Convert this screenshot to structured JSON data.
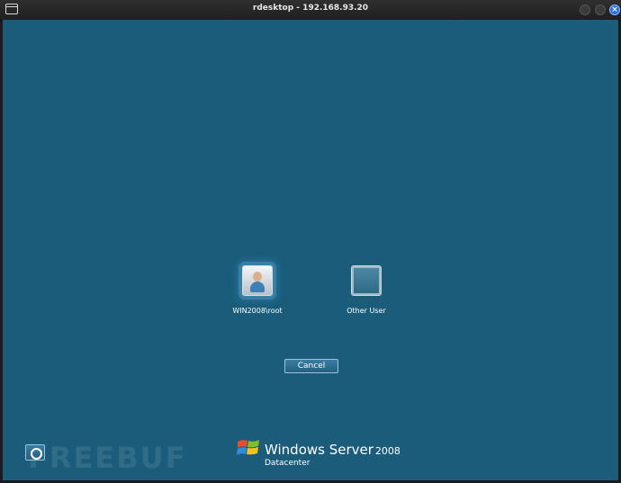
{
  "window": {
    "title": "rdesktop - 192.168.93.20"
  },
  "colors": {
    "desktop_bg": "#1a5c7a",
    "titlebar_bg": "#2a2a2a",
    "close_button": "#2f6fd6"
  },
  "login": {
    "tiles": [
      {
        "label": "WIN2008\\root",
        "icon": "user-avatar-icon",
        "selected": true
      },
      {
        "label": "Other User",
        "icon": "blank-user-icon",
        "selected": false
      }
    ],
    "cancel_label": "Cancel"
  },
  "ease_of_access": {
    "icon": "ease-of-access-icon"
  },
  "branding": {
    "brand": "Windows Server",
    "version": "2008",
    "edition": "Datacenter",
    "logo_icon": "windows-flag-icon"
  },
  "watermark": {
    "text": "FREEBUF"
  }
}
